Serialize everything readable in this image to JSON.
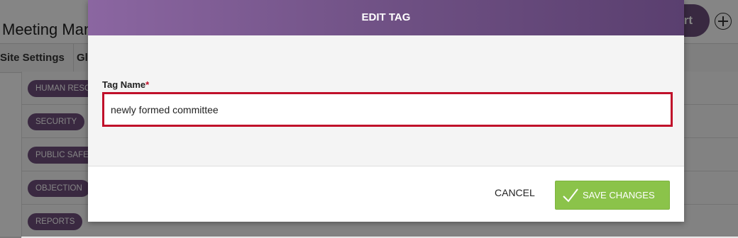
{
  "background": {
    "page_title": "Meeting Man",
    "nav": {
      "site_settings": "Site Settings",
      "gl": "Gl"
    },
    "start_button": "rt",
    "tags": [
      "HUMAN RESOURCES",
      "SECURITY",
      "PUBLIC SAFETY",
      "OBJECTION",
      "REPORTS"
    ],
    "icons": {
      "add": "plus-circle-icon"
    }
  },
  "modal": {
    "title": "EDIT TAG",
    "field_label": "Tag Name",
    "required_mark": "*",
    "tag_name_value": "newly formed committee",
    "cancel_label": "CANCEL",
    "save_label": "SAVE CHANGES",
    "icons": {
      "save": "check-icon"
    }
  },
  "colors": {
    "header_purple": "#6d4f82",
    "tag_purple": "#6f4f7e",
    "error_red": "#c0102a",
    "save_green": "#8bc34a"
  }
}
